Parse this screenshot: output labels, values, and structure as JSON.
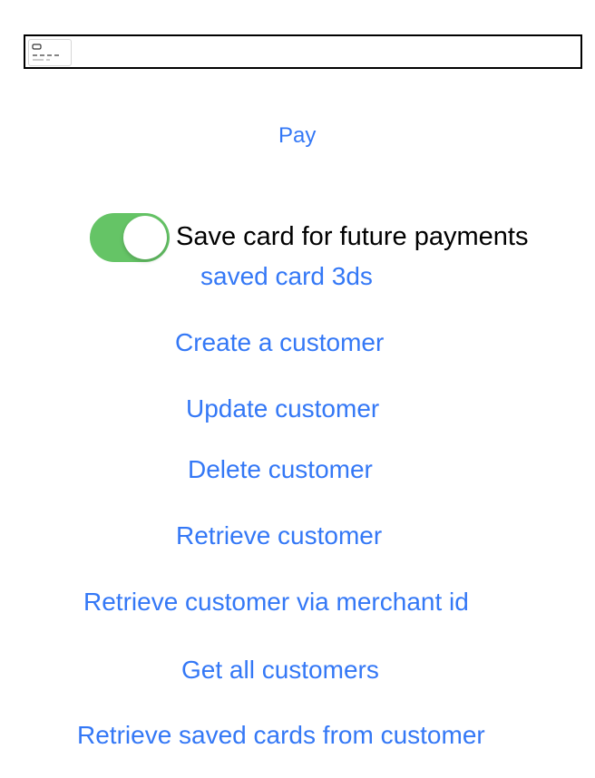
{
  "card_field": {
    "icon": "credit-card-icon",
    "value": "",
    "placeholder": ""
  },
  "pay_button": "Pay",
  "save_card": {
    "label": "Save card for future payments",
    "enabled": true,
    "toggle_color": "#65c466"
  },
  "actions": {
    "saved_card_3ds": "saved card 3ds",
    "create_customer": "Create a customer",
    "update_customer": "Update customer",
    "delete_customer": "Delete customer",
    "retrieve_customer": "Retrieve customer",
    "retrieve_customer_merchant_id": "Retrieve customer via merchant id",
    "get_all_customers": "Get all customers",
    "retrieve_saved_cards": "Retrieve saved cards from customer"
  },
  "colors": {
    "link": "#3478f6",
    "text": "#000000",
    "background": "#ffffff"
  }
}
